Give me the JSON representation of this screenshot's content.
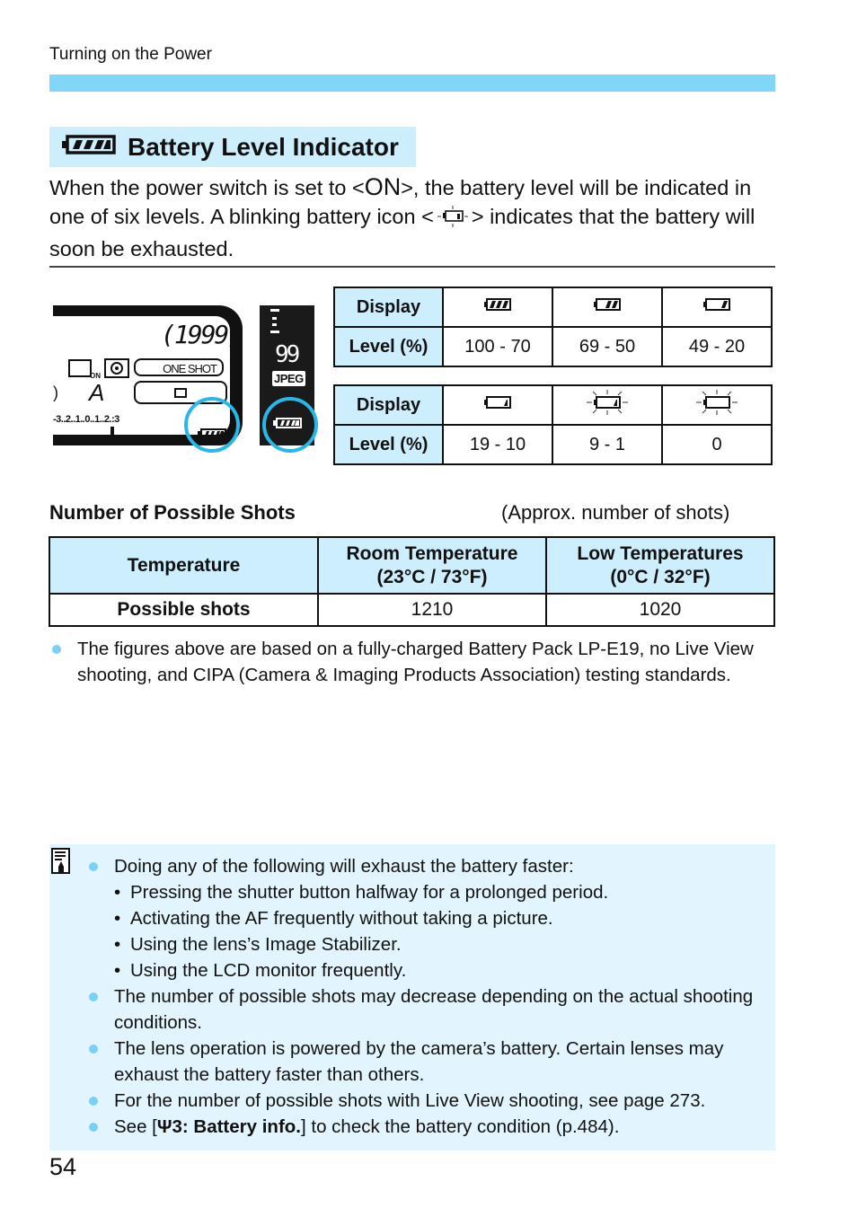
{
  "header": {
    "running_title": "Turning on the Power"
  },
  "section": {
    "title": "Battery Level Indicator",
    "title_icon": "battery-full-icon"
  },
  "intro": {
    "part1": "When the power switch is set to <",
    "on_symbol": "ON",
    "part2": ">, the battery level will be indicated in one of six levels. A blinking battery icon <",
    "part3": "> indicates that the battery will soon be exhausted."
  },
  "lcd_panel": {
    "shots_remaining": "(1999)",
    "af_mode": "ONE SHOT",
    "mode_letter": "A",
    "exposure_scale": "-3..2..1..0..1..2.:3",
    "on_badge": "ON",
    "battery_icon": "battery-full-icon"
  },
  "viewfinder": {
    "burst": "99",
    "quality": "JPEG",
    "battery_icon": "battery-full-icon"
  },
  "battery_table_1": {
    "display_label": "Display",
    "level_label": "Level (%)",
    "columns": [
      {
        "icon": "battery-full-icon",
        "level": "100 - 70",
        "bars": 3,
        "blink": false
      },
      {
        "icon": "battery-two-bars-icon",
        "level": "69 - 50",
        "bars": 2,
        "blink": false
      },
      {
        "icon": "battery-one-bar-icon",
        "level": "49 - 20",
        "bars": 1,
        "blink": false
      }
    ]
  },
  "battery_table_2": {
    "display_label": "Display",
    "level_label": "Level (%)",
    "columns": [
      {
        "icon": "battery-low-icon",
        "level": "19 - 10",
        "bars": 0.5,
        "blink": false
      },
      {
        "icon": "battery-blinking-low-icon",
        "level": "9 - 1",
        "bars": 0.5,
        "blink": true
      },
      {
        "icon": "battery-blinking-empty-icon",
        "level": "0",
        "bars": 0,
        "blink": true
      }
    ]
  },
  "shots": {
    "title": "Number of Possible Shots",
    "note": "(Approx. number of shots)",
    "header": [
      "Temperature",
      "Room Temperature",
      "(23°C / 73°F)",
      "Low Temperatures",
      "(0°C / 32°F)"
    ],
    "row_label": "Possible shots",
    "values": [
      "1210",
      "1020"
    ]
  },
  "footnote": "The figures above are based on a fully-charged Battery Pack LP-E19, no Live View shooting, and CIPA (Camera & Imaging Products Association) testing standards.",
  "memo": {
    "icon": "memo-pencil-icon",
    "items": [
      {
        "text": "Doing any of the following will exhaust the battery faster:",
        "sub": [
          "Pressing the shutter button halfway for a prolonged period.",
          "Activating the AF frequently without taking a picture.",
          "Using the lens’s Image Stabilizer.",
          "Using the LCD monitor frequently."
        ]
      },
      {
        "text": "The number of possible shots may decrease depending on the actual shooting conditions."
      },
      {
        "text": "The lens operation is powered by the camera’s battery. Certain lenses may exhaust the battery faster than others."
      },
      {
        "text": "For the number of possible shots with Live View shooting, see page 273."
      },
      {
        "pre": "See [",
        "menu_icon": "setup-wrench-icon",
        "bold": "3: Battery info.",
        "post": "] to check the battery condition (p.484)."
      }
    ]
  },
  "page_number": "54"
}
